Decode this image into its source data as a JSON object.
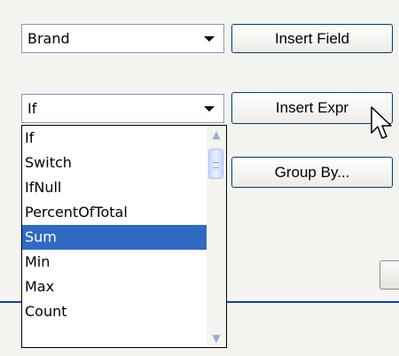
{
  "field_select": {
    "value": "Brand"
  },
  "buttons": {
    "insert_field": "Insert Field",
    "insert_expr": "Insert Expr",
    "group_by": "Group By..."
  },
  "expression_select": {
    "value": "If",
    "options": [
      "If",
      "Switch",
      "IfNull",
      "PercentOfTotal",
      "Sum",
      "Min",
      "Max",
      "Count"
    ],
    "highlighted": "Sum"
  },
  "icons": {
    "dropdown": "chevron-down-icon",
    "scroll_up": "scroll-up-icon",
    "scroll_down": "scroll-down-icon",
    "cursor": "mouse-pointer-icon"
  },
  "colors": {
    "selection": "#316ac5",
    "separator": "#0a3ec2",
    "border": "#7f9db9"
  }
}
